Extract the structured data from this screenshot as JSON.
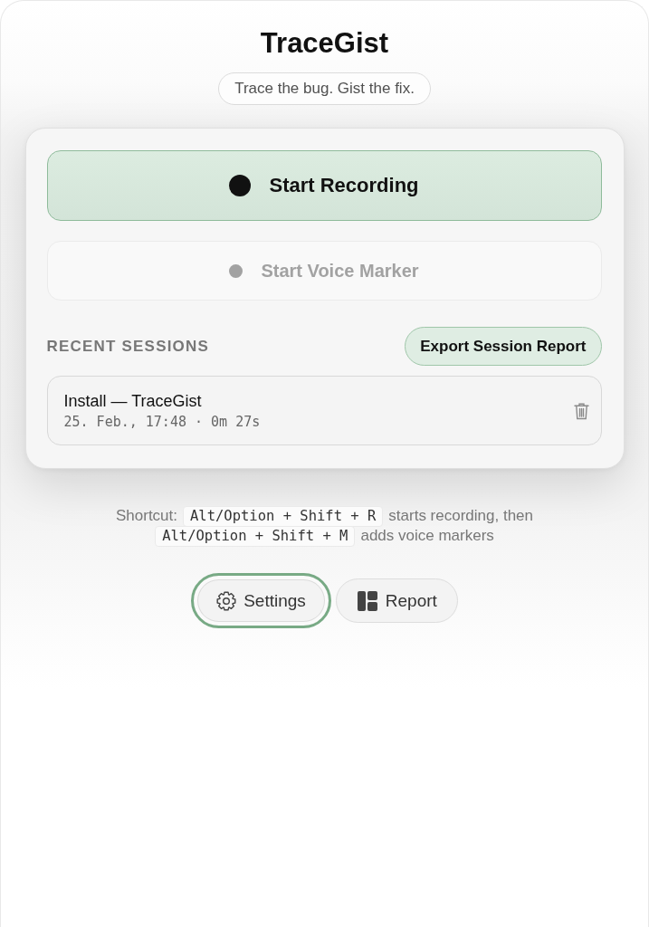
{
  "app": {
    "title": "TraceGist",
    "tagline": "Trace the bug. Gist the fix."
  },
  "actions": [
    {
      "kind": "record",
      "label": "Start Recording",
      "disabled": false
    },
    {
      "kind": "voice_marker",
      "label": "Start Voice Marker",
      "disabled": true
    }
  ],
  "recent_sessions": {
    "heading": "RECENT SESSIONS",
    "export_button": "Export Session Report",
    "sessions": [
      {
        "title": "Install — TraceGist",
        "meta": "25. Feb., 17:48 · 0m 27s"
      }
    ]
  },
  "shortcut_hint": {
    "lines": [
      [
        {
          "kind": "text",
          "text": "Shortcut:"
        },
        {
          "kind": "key",
          "text": "Alt/Option + Shift + R"
        },
        {
          "kind": "text",
          "text": "starts recording, then"
        }
      ],
      [
        {
          "kind": "key",
          "text": "Alt/Option + Shift + M"
        },
        {
          "kind": "text",
          "text": "adds voice markers"
        }
      ]
    ]
  },
  "footer_buttons": [
    {
      "kind": "settings",
      "label": "Settings",
      "focused": true
    },
    {
      "kind": "report",
      "label": "Report",
      "focused": false
    }
  ]
}
